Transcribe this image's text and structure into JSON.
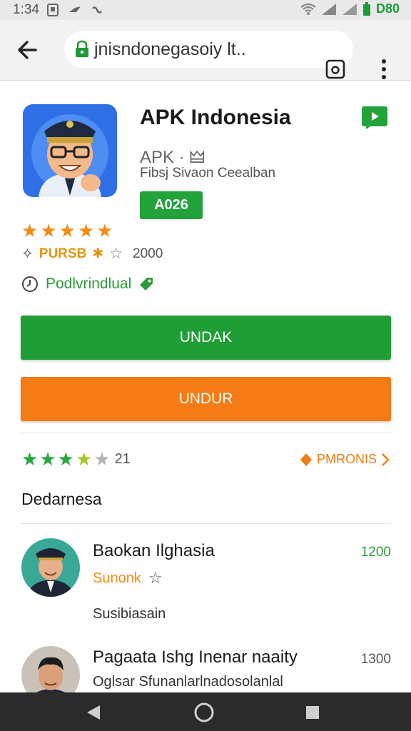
{
  "status_bar": {
    "time": "1:34",
    "battery": "D80"
  },
  "browser": {
    "url": "jnisndonegasoiy lt.."
  },
  "app": {
    "title": "APK Indonesia",
    "subtitle": "APK · 🜲",
    "developer": "Fibsj Sivaon Ceealban",
    "version_badge": "A026",
    "stats_label": "PURSB",
    "stats_count": "2000",
    "publisher": "Podlvrindlual"
  },
  "buttons": {
    "primary": "UNDAK",
    "secondary": "UNDUR"
  },
  "rating": {
    "count": "21",
    "link_label": "PMRONIS"
  },
  "section": {
    "title": "Dedarnesa"
  },
  "reviews": [
    {
      "name": "Baokan Ilghasia",
      "tag": "Sunonk",
      "text": "Susibiasain",
      "number": "1200",
      "number_color": "#2e9a3c"
    },
    {
      "name": "Pagaata Ishg Inenar naaity",
      "text": "Oglsar Sfunanlarlnadosolanlal",
      "number": "1300",
      "number_color": "#555555"
    }
  ],
  "colors": {
    "green": "#1f9e35",
    "orange": "#f57b14",
    "star_orange": "#f08c12",
    "star_green": "#26a63e"
  },
  "icons": [
    "back-arrow-icon",
    "lock-icon",
    "reader-mode-icon",
    "more-vert-icon",
    "play-store-icon",
    "clock-icon",
    "tag-icon",
    "nav-back-icon",
    "nav-home-icon",
    "nav-recents-icon"
  ]
}
